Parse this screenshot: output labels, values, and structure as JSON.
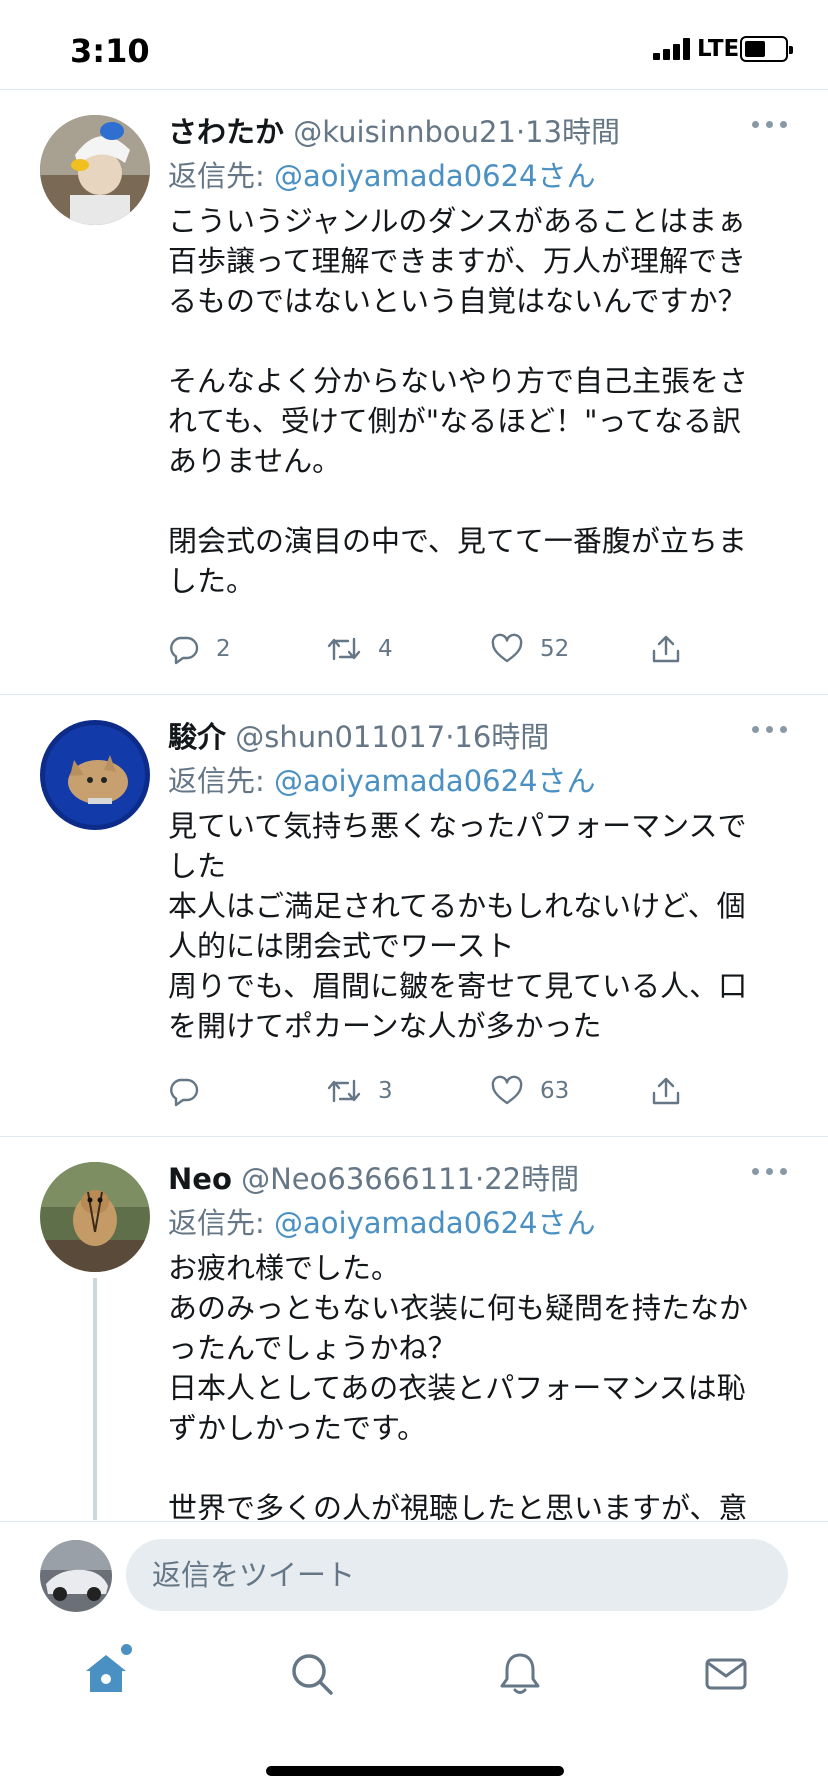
{
  "status_bar": {
    "time": "3:10",
    "network": "LTE"
  },
  "colors": {
    "accent": "#4a90c2",
    "text": "#14171a",
    "secondary": "#657786",
    "divider": "#e1e8ed"
  },
  "tweets": [
    {
      "name": "さわたか",
      "handle": "@kuisinnbou21",
      "separator": "·",
      "time_ago": "13時間",
      "reply_prefix": "返信先: ",
      "reply_mention": "@aoiyamada0624さん",
      "text": "こういうジャンルのダンスがあることはまぁ\n百歩譲って理解できますが、万人が理解でき\nるものではないという自覚はないんですか？\n\nそんなよく分からないやり方で自己主張をさ\nれても、受けて側が\"なるほど！\"ってなる訳\nありません。\n\n閉会式の演目の中で、見てて一番腹が立ちま\nした。",
      "reply_count": "2",
      "retweet_count": "4",
      "like_count": "52"
    },
    {
      "name": "駿介",
      "handle": "@shun011017",
      "separator": "·",
      "time_ago": "16時間",
      "reply_prefix": "返信先: ",
      "reply_mention": "@aoiyamada0624さん",
      "text": "見ていて気持ち悪くなったパフォーマンスで\nした\n本人はご満足されてるかもしれないけど、個\n人的には閉会式でワースト\n周りでも、眉間に皺を寄せて見ている人、口\nを開けてポカーンな人が多かった",
      "reply_count": "",
      "retweet_count": "3",
      "like_count": "63"
    },
    {
      "name": "Neo",
      "handle": "@Neo63666111",
      "separator": "·",
      "time_ago": "22時間",
      "reply_prefix": "返信先: ",
      "reply_mention": "@aoiyamada0624さん",
      "text": "お疲れ様でした。\nあのみっともない衣装に何も疑問を持たなか\nったんでしょうかね？\n日本人としてあの衣装とパフォーマンスは恥\nずかしかったです。\n\n世界で多くの人が視聴したと思いますが、意"
    }
  ],
  "composer": {
    "placeholder": "返信をツイート"
  },
  "tabs": [
    {
      "icon": "home-icon"
    },
    {
      "icon": "search-icon"
    },
    {
      "icon": "bell-icon"
    },
    {
      "icon": "mail-icon"
    }
  ]
}
